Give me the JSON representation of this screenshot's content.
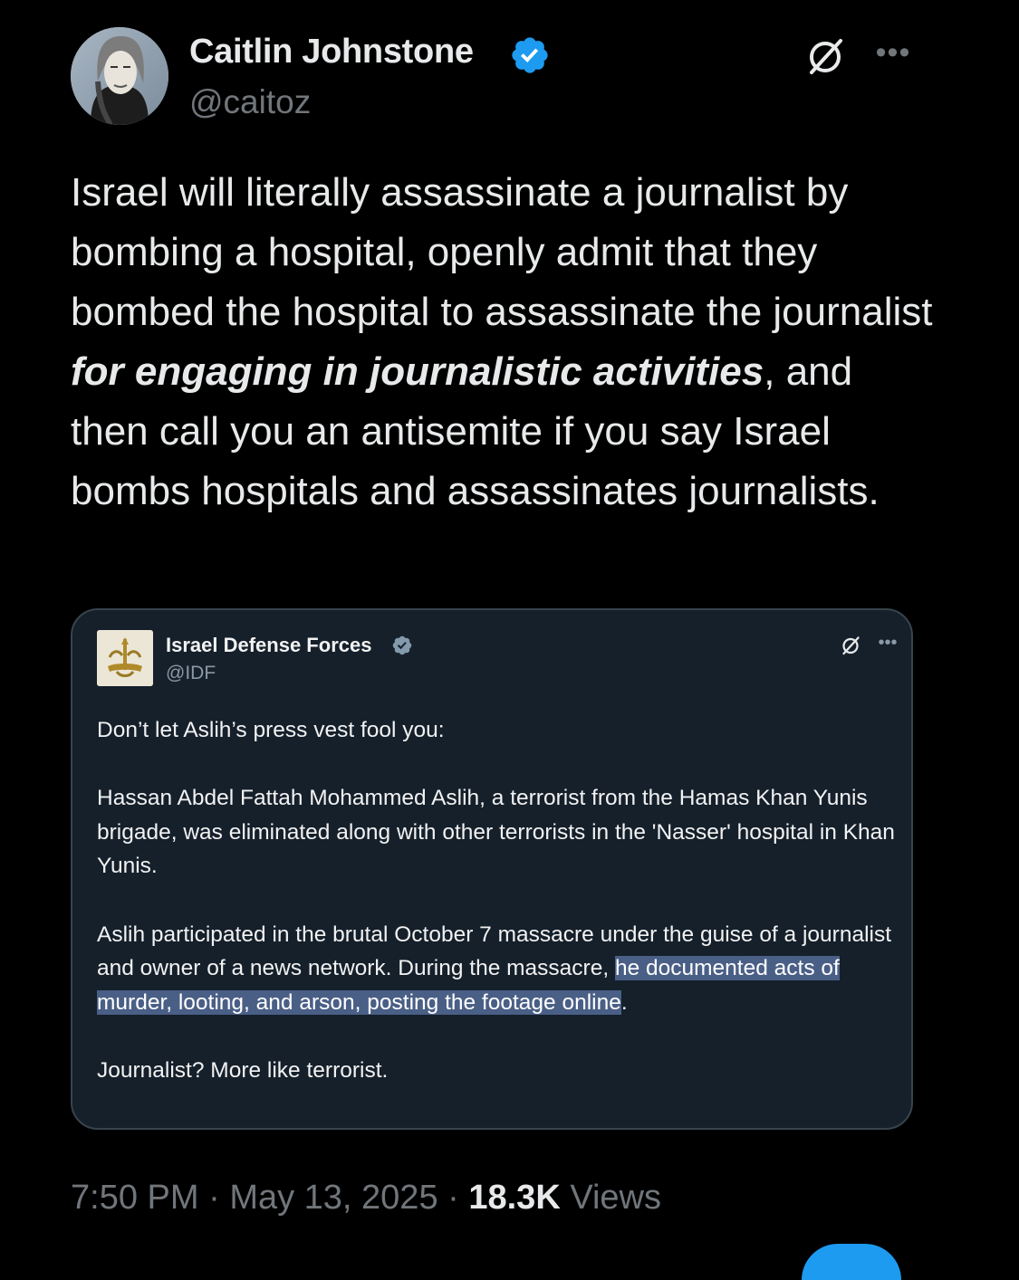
{
  "author": {
    "name": "Caitlin Johnstone",
    "handle": "@caitoz",
    "verified": true
  },
  "tweet": {
    "text_before": "Israel will literally assassinate a journalist by bombing a hospital, openly admit that they bombed the hospital to assassinate the journalist ",
    "text_emphasis": "for engaging in journalistic activities",
    "text_after": ", and then call you an antisemite if you say Israel bombs hospitals and assassinates journalists."
  },
  "quote": {
    "author_name": "Israel Defense Forces",
    "author_handle": "@IDF",
    "verified": true,
    "para1": "Don’t let Aslih’s press vest fool you:",
    "para2": "Hassan Abdel Fattah Mohammed Aslih, a terrorist from the Hamas Khan Yunis brigade, was eliminated along with other terrorists in the 'Nasser' hospital in Khan Yunis.",
    "para3_before": "Aslih participated in the brutal October 7 massacre under the guise of a journalist and owner of a news network. During the massacre, ",
    "para3_highlight": "he documented acts of murder, looting, and arson, posting the footage online",
    "para3_after": ".",
    "para4": "Journalist? More like terrorist."
  },
  "meta": {
    "time": "7:50 PM",
    "separator": " · ",
    "date": "May 13, 2025",
    "views_count": "18.3K",
    "views_label": " Views"
  },
  "icons": {
    "verified": "verified-badge-icon",
    "grok": "grok-icon",
    "more": "more-options-icon"
  },
  "colors": {
    "background": "#000000",
    "text": "#e7e9ea",
    "secondary": "#71767b",
    "verified_blue": "#1d9bf0",
    "affiliate_gray": "#829aab",
    "quote_background": "#15202b",
    "highlight": "#4a5f86"
  }
}
